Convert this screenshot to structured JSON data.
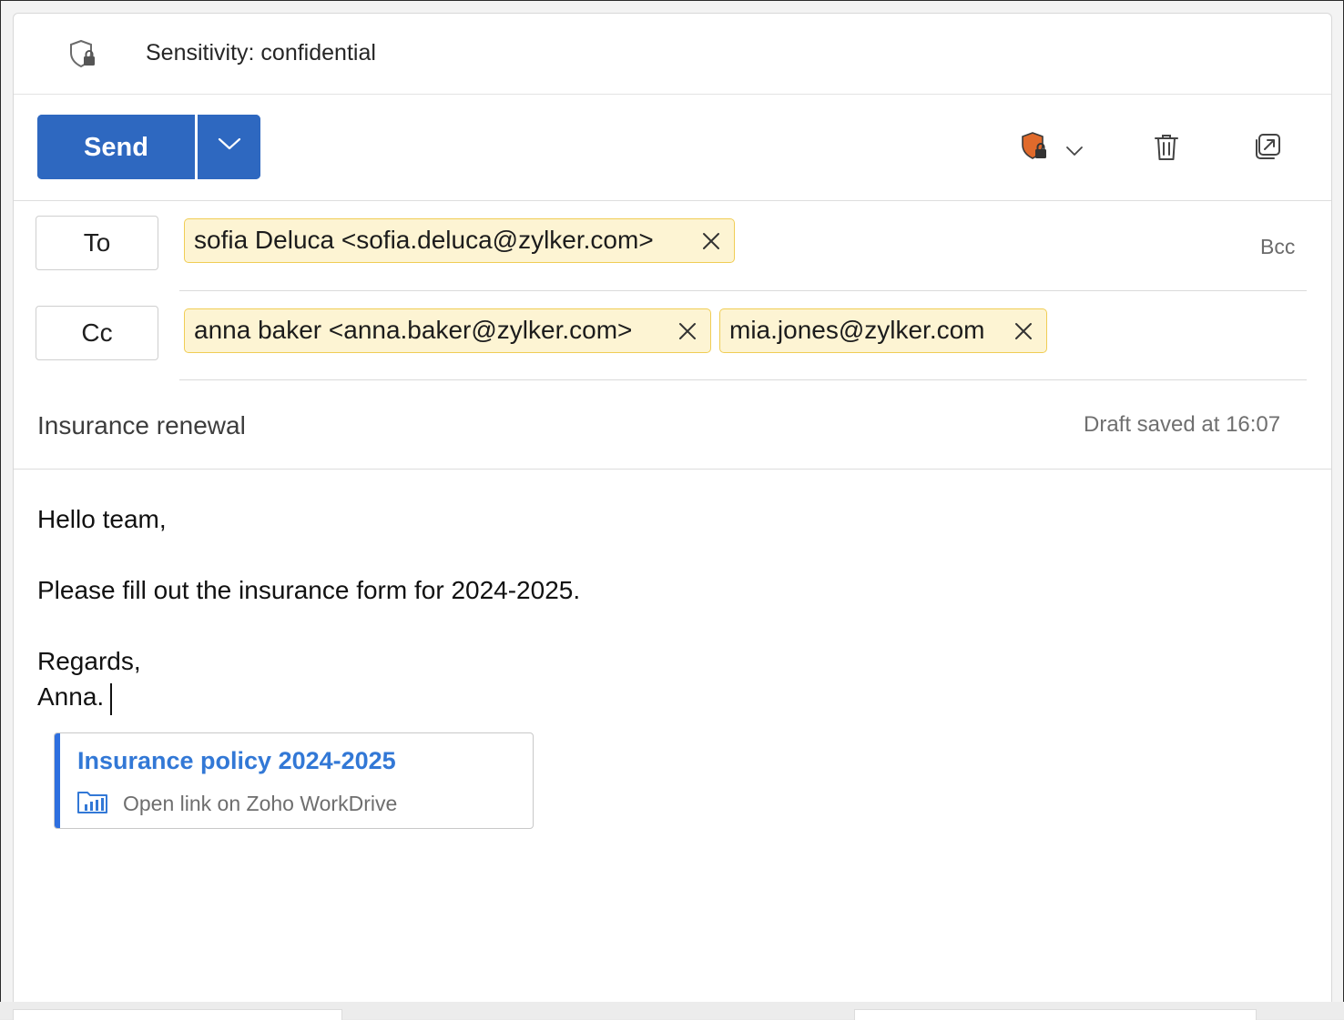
{
  "sensitivity": {
    "label": "Sensitivity: confidential",
    "icon": "shield-lock-icon"
  },
  "toolbar": {
    "send_label": "Send",
    "send_options_icon": "chevron-down-icon",
    "protection_icon": "shield-lock-icon",
    "protection_dropdown_icon": "chevron-down-icon",
    "delete_icon": "trash-icon",
    "popout_icon": "popout-icon",
    "send_color": "#2e68c0",
    "protection_color": "#e06a2b"
  },
  "recipients": {
    "to_label": "To",
    "cc_label": "Cc",
    "bcc_label": "Bcc",
    "to": [
      {
        "text": "sofia Deluca <sofia.deluca@zylker.com>"
      }
    ],
    "cc": [
      {
        "text": "anna baker <anna.baker@zylker.com>"
      },
      {
        "text": "mia.jones@zylker.com"
      }
    ],
    "chip_bg": "#fdf4d3",
    "chip_border": "#f0cd55"
  },
  "subject": {
    "value": "Insurance renewal",
    "status": "Draft saved at 16:07"
  },
  "body": {
    "greeting": "Hello team,",
    "line1": "Please fill out the insurance form for 2024-2025.",
    "closing": "Regards,",
    "signature": "Anna."
  },
  "attachment_link": {
    "title": "Insurance policy 2024-2025",
    "subtitle": "Open link on Zoho WorkDrive",
    "icon": "workdrive-folder-icon",
    "accent_color": "#2e6fdf"
  }
}
